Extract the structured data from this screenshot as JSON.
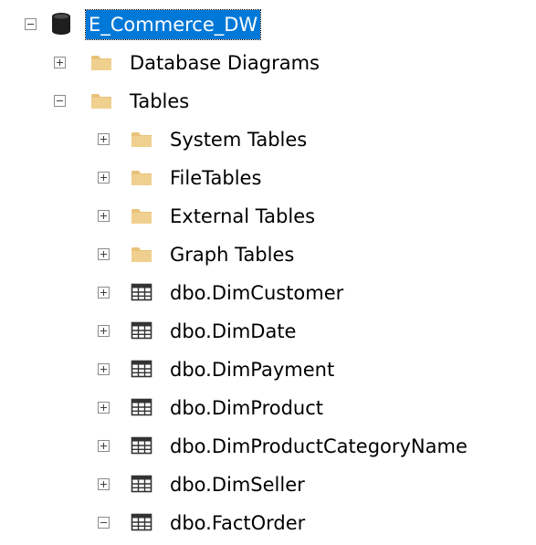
{
  "root": {
    "label": "E_Commerce_DW",
    "icon": "database-icon",
    "expanded": true,
    "selected": true
  },
  "nodes": [
    {
      "label": "Database Diagrams",
      "icon": "folder-icon",
      "expanded": false
    },
    {
      "label": "Tables",
      "icon": "folder-icon",
      "expanded": true
    },
    {
      "label": "System Tables",
      "icon": "folder-icon",
      "expanded": false
    },
    {
      "label": "FileTables",
      "icon": "folder-icon",
      "expanded": false
    },
    {
      "label": "External Tables",
      "icon": "folder-icon",
      "expanded": false
    },
    {
      "label": "Graph Tables",
      "icon": "folder-icon",
      "expanded": false
    },
    {
      "label": "dbo.DimCustomer",
      "icon": "table-icon",
      "expanded": false
    },
    {
      "label": "dbo.DimDate",
      "icon": "table-icon",
      "expanded": false
    },
    {
      "label": "dbo.DimPayment",
      "icon": "table-icon",
      "expanded": false
    },
    {
      "label": "dbo.DimProduct",
      "icon": "table-icon",
      "expanded": false
    },
    {
      "label": "dbo.DimProductCategoryName",
      "icon": "table-icon",
      "expanded": false
    },
    {
      "label": "dbo.DimSeller",
      "icon": "table-icon",
      "expanded": false
    },
    {
      "label": "dbo.FactOrder",
      "icon": "table-icon",
      "expanded": true
    }
  ],
  "colors": {
    "selection": "#0078d7",
    "folder": "#e8c27a",
    "database": "#1e1e1e",
    "table": "#333333"
  }
}
